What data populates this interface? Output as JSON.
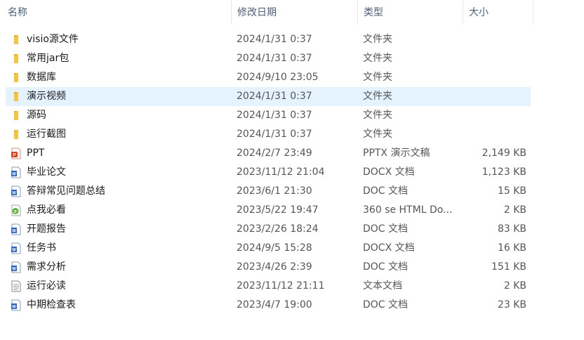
{
  "columns": {
    "name": "名称",
    "date": "修改日期",
    "type": "类型",
    "size": "大小",
    "sort_indicator": "^"
  },
  "selected_row_index": 3,
  "files": [
    {
      "name": "visio源文件",
      "date": "2024/1/31 0:37",
      "type": "文件夹",
      "size": "",
      "icon": "folder-icon"
    },
    {
      "name": "常用jar包",
      "date": "2024/1/31 0:37",
      "type": "文件夹",
      "size": "",
      "icon": "folder-icon"
    },
    {
      "name": "数据库",
      "date": "2024/9/10 23:05",
      "type": "文件夹",
      "size": "",
      "icon": "folder-icon"
    },
    {
      "name": "演示视频",
      "date": "2024/1/31 0:37",
      "type": "文件夹",
      "size": "",
      "icon": "folder-icon"
    },
    {
      "name": "源码",
      "date": "2024/1/31 0:37",
      "type": "文件夹",
      "size": "",
      "icon": "folder-icon"
    },
    {
      "name": "运行截图",
      "date": "2024/1/31 0:37",
      "type": "文件夹",
      "size": "",
      "icon": "folder-icon"
    },
    {
      "name": "PPT",
      "date": "2024/2/7 23:49",
      "type": "PPTX 演示文稿",
      "size": "2,149 KB",
      "icon": "powerpoint-file-icon"
    },
    {
      "name": "毕业论文",
      "date": "2023/11/12 21:04",
      "type": "DOCX 文档",
      "size": "1,123 KB",
      "icon": "word-file-icon"
    },
    {
      "name": "答辩常见问题总结",
      "date": "2023/6/1 21:30",
      "type": "DOC 文档",
      "size": "15 KB",
      "icon": "word-file-icon"
    },
    {
      "name": "点我必看",
      "date": "2023/5/22 19:47",
      "type": "360 se HTML Do...",
      "size": "2 KB",
      "icon": "html-file-icon"
    },
    {
      "name": "开题报告",
      "date": "2023/2/26 18:24",
      "type": "DOC 文档",
      "size": "83 KB",
      "icon": "word-file-icon"
    },
    {
      "name": "任务书",
      "date": "2024/9/5 15:28",
      "type": "DOCX 文档",
      "size": "16 KB",
      "icon": "word-file-icon"
    },
    {
      "name": "需求分析",
      "date": "2023/4/26 2:39",
      "type": "DOC 文档",
      "size": "151 KB",
      "icon": "word-file-icon"
    },
    {
      "name": "运行必读",
      "date": "2023/11/12 21:11",
      "type": "文本文档",
      "size": "2 KB",
      "icon": "text-file-icon"
    },
    {
      "name": "中期检查表",
      "date": "2023/4/7 19:00",
      "type": "DOC 文档",
      "size": "23 KB",
      "icon": "word-file-icon"
    }
  ],
  "colors": {
    "folder": "#f4c542",
    "word": "#2b64c6",
    "powerpoint": "#d24726",
    "html": "#5fb336",
    "selection": "#e5f3ff",
    "header_text": "#4c607a"
  }
}
